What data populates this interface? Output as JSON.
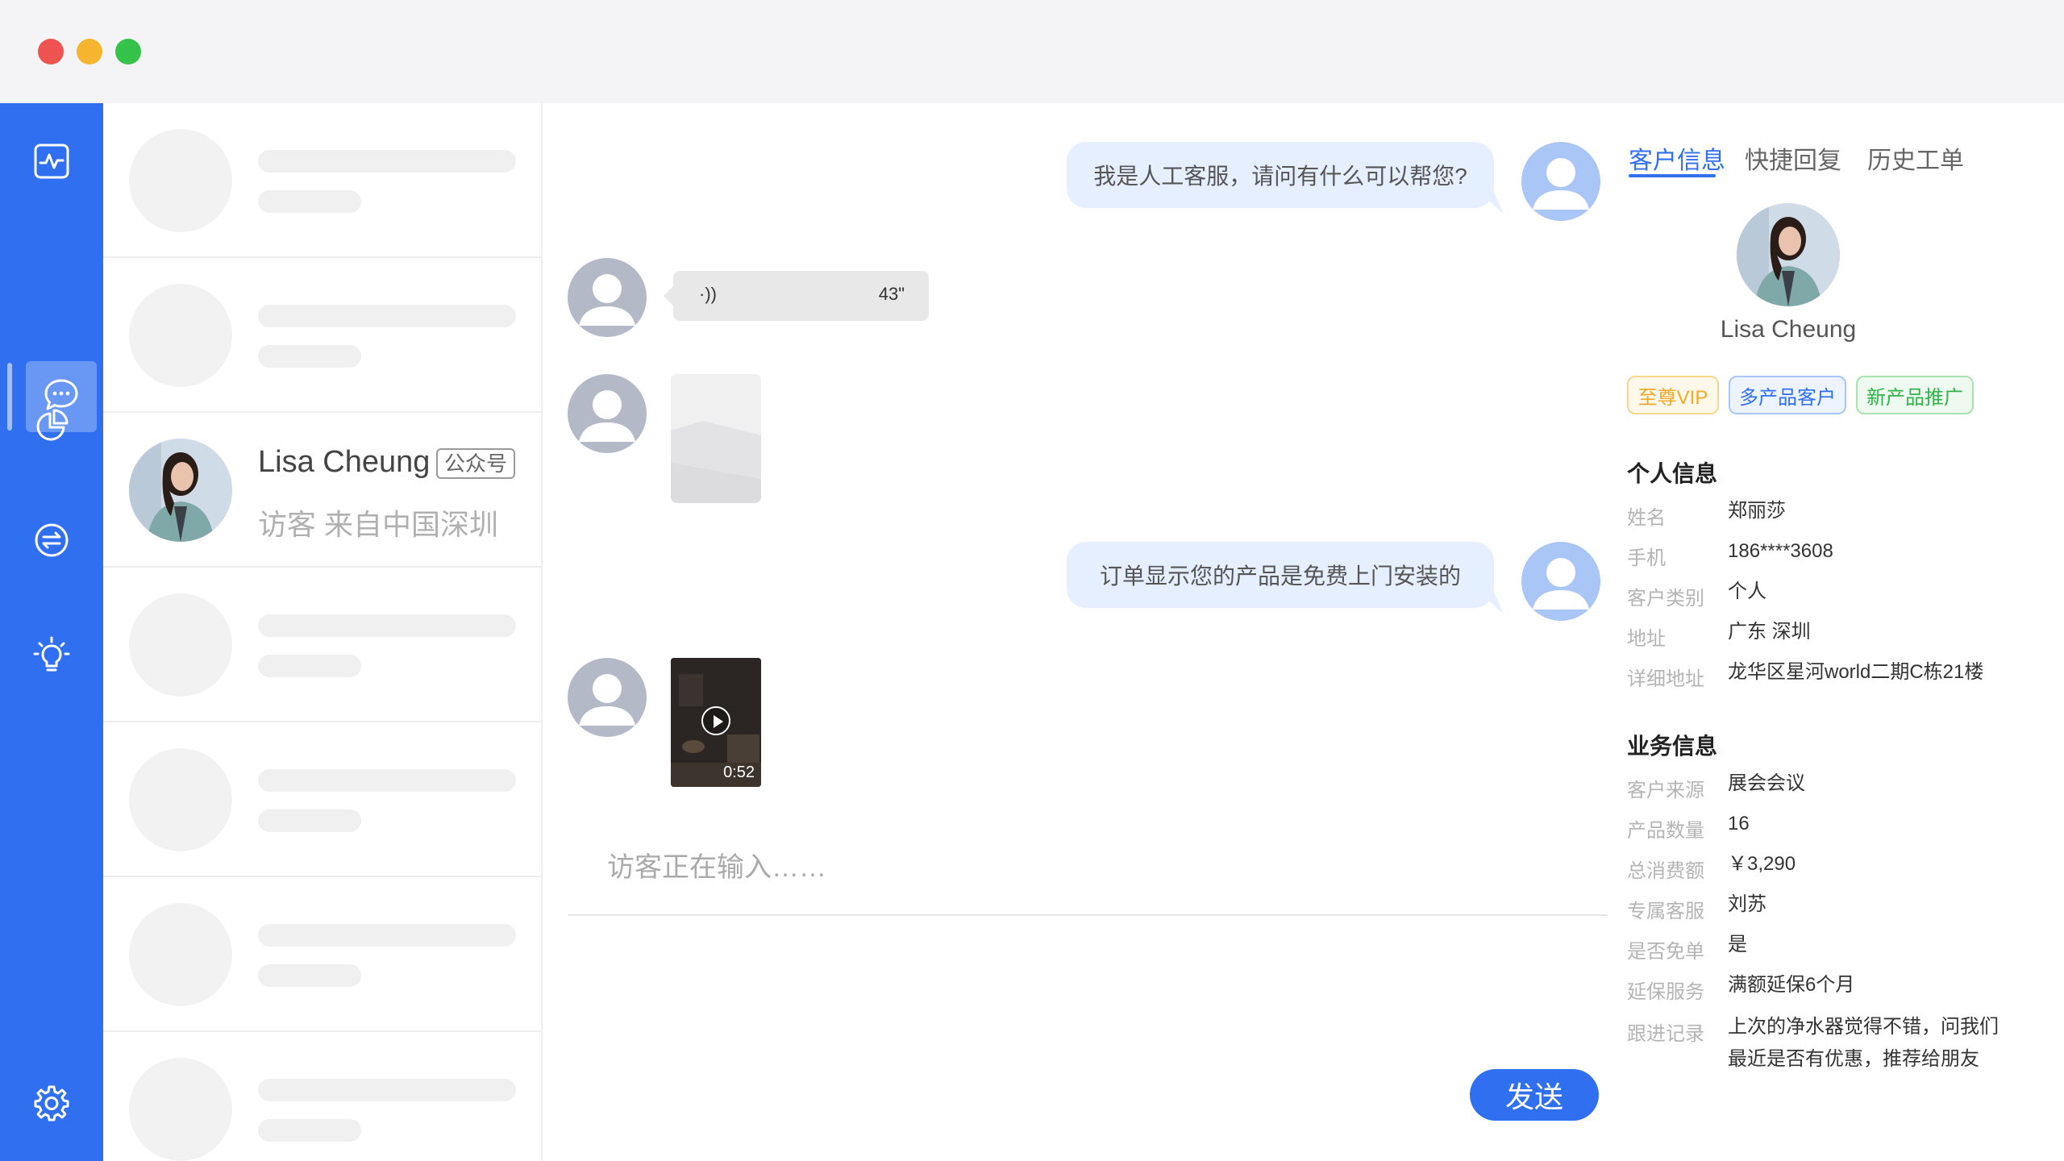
{
  "window": {
    "controls": [
      "close",
      "minimize",
      "maximize"
    ]
  },
  "rail": {
    "items": [
      {
        "icon": "activity-chart-icon"
      },
      {
        "icon": "chat-bubble-icon",
        "active": true
      },
      {
        "icon": "pie-chart-icon"
      },
      {
        "icon": "exchange-icon"
      },
      {
        "icon": "lightbulb-icon"
      },
      {
        "icon": "gear-icon"
      }
    ],
    "accent": "#2f6ff0"
  },
  "conversations": {
    "active": {
      "name": "Lisa Cheung",
      "tag": "公众号",
      "subtitle": "访客 来自中国深圳"
    }
  },
  "chat": {
    "messages": [
      {
        "from": "agent",
        "type": "text",
        "text": "我是人工客服，请问有什么可以帮您?"
      },
      {
        "from": "visitor",
        "type": "voice",
        "icon": "·))",
        "duration": "43\""
      },
      {
        "from": "visitor",
        "type": "image"
      },
      {
        "from": "agent",
        "type": "text",
        "text": "订单显示您的产品是免费上门安装的"
      },
      {
        "from": "visitor",
        "type": "video",
        "duration": "0:52"
      }
    ],
    "typing_indicator": "访客正在输入……",
    "send_label": "发送"
  },
  "info": {
    "tabs": [
      "客户信息",
      "快捷回复",
      "历史工单"
    ],
    "active_tab": "客户信息",
    "customer_name": "Lisa Cheung",
    "badges": [
      {
        "label": "至尊VIP",
        "color": "#f5b52e"
      },
      {
        "label": "多产品客户",
        "color": "#2f6ff0"
      },
      {
        "label": "新产品推广",
        "color": "#34c24a"
      }
    ],
    "personal": {
      "title": "个人信息",
      "rows": [
        {
          "label": "姓名",
          "value": "郑丽莎"
        },
        {
          "label": "手机",
          "value": "186****3608"
        },
        {
          "label": "客户类别",
          "value": "个人"
        },
        {
          "label": "地址",
          "value": "广东 深圳"
        },
        {
          "label": "详细地址",
          "value": "龙华区星河world二期C栋21楼"
        }
      ]
    },
    "business": {
      "title": "业务信息",
      "rows": [
        {
          "label": "客户来源",
          "value": "展会会议"
        },
        {
          "label": "产品数量",
          "value": "16"
        },
        {
          "label": "总消费额",
          "value": "￥3,290"
        },
        {
          "label": "专属客服",
          "value": "刘苏"
        },
        {
          "label": "是否免单",
          "value": "是"
        },
        {
          "label": "延保服务",
          "value": "满额延保6个月"
        },
        {
          "label": "跟进记录",
          "value": "上次的净水器觉得不错，问我们最近是否有优惠，推荐给朋友"
        }
      ]
    }
  }
}
